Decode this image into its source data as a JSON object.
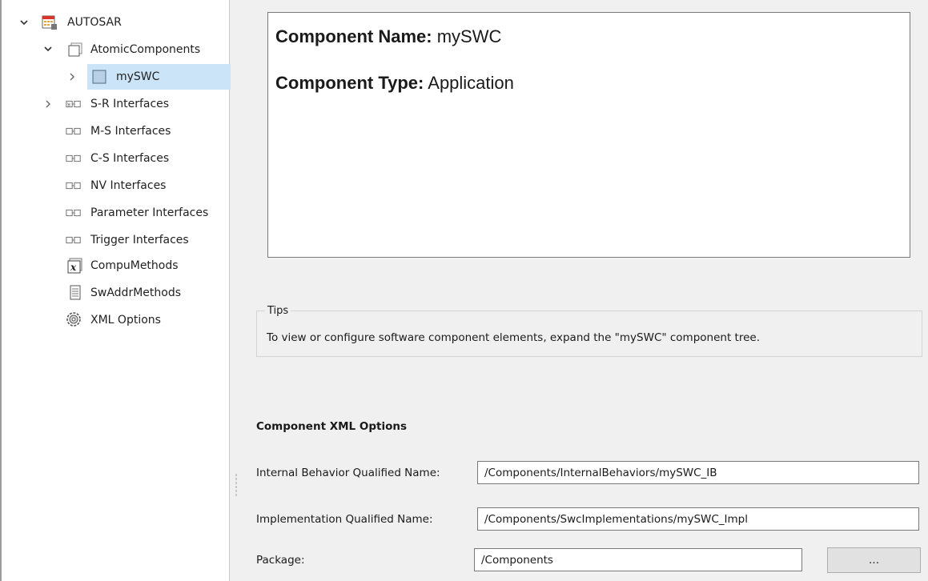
{
  "tree": {
    "root": {
      "label": "AUTOSAR",
      "expanded": true
    },
    "atomic_components": {
      "label": "AtomicComponents",
      "expanded": true
    },
    "selected_component": {
      "label": "mySWC",
      "expanded": false,
      "selected": true
    },
    "sr_interfaces": {
      "label": "S-R Interfaces",
      "expanded": false
    },
    "ms_interfaces": {
      "label": "M-S Interfaces"
    },
    "cs_interfaces": {
      "label": "C-S Interfaces"
    },
    "nv_interfaces": {
      "label": "NV Interfaces"
    },
    "parameter_interfaces": {
      "label": "Parameter Interfaces"
    },
    "trigger_interfaces": {
      "label": "Trigger Interfaces"
    },
    "compu_methods": {
      "label": "CompuMethods"
    },
    "sw_addr_methods": {
      "label": "SwAddrMethods"
    },
    "xml_options": {
      "label": "XML Options"
    }
  },
  "summary": {
    "name_label": "Component Name:",
    "name_value": "mySWC",
    "type_label": "Component Type:",
    "type_value": "Application"
  },
  "tips": {
    "title": "Tips",
    "text": "To view or configure software component elements, expand the \"mySWC\" component tree."
  },
  "xml_options": {
    "section_title": "Component XML Options",
    "internal_behavior_label": "Internal Behavior Qualified Name:",
    "internal_behavior_value": "/Components/InternalBehaviors/mySWC_IB",
    "implementation_label": "Implementation Qualified Name:",
    "implementation_value": "/Components/SwcImplementations/mySWC_Impl",
    "package_label": "Package:",
    "package_value": "/Components",
    "browse_label": "..."
  },
  "icons": {
    "autosar": "autosar-package-icon",
    "folder": "component-folder-icon",
    "component": "component-box-icon",
    "interface": "interface-icon",
    "compu": "function-x-icon",
    "swaddr": "document-list-icon",
    "options": "gear-icon"
  },
  "colors": {
    "selection": "#cce4f7",
    "autosar_red": "#d9342b"
  }
}
